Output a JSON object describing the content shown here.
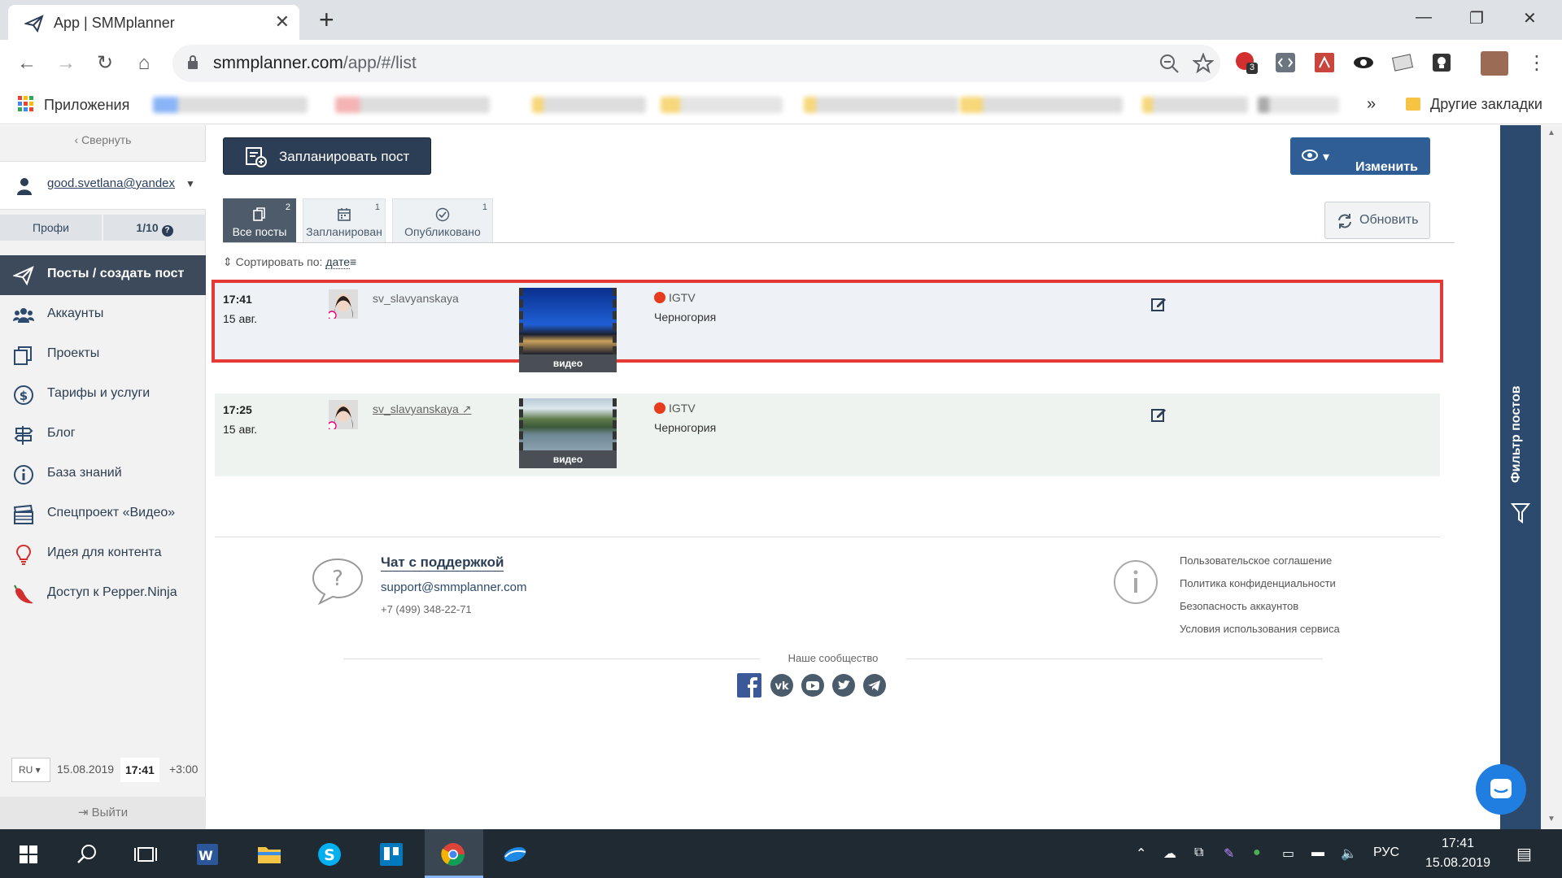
{
  "browser": {
    "tab_title": "App | SMMplanner",
    "url_host": "smmplanner.com",
    "url_path": "/app/#/list",
    "ext_badge": "3",
    "bookmarks_apps": "Приложения",
    "bookmarks_more": "»",
    "bookmarks_other": "Другие закладки"
  },
  "sidebar": {
    "collapse": "‹ Свернуть",
    "account": "good.svetlana@yandex",
    "plan_name": "Профи",
    "plan_usage": "1/10",
    "menu": [
      {
        "label": "Посты / создать пост",
        "icon": "paper-plane-icon"
      },
      {
        "label": "Аккаунты",
        "icon": "users-icon"
      },
      {
        "label": "Проекты",
        "icon": "projects-icon"
      },
      {
        "label": "Тарифы и услуги",
        "icon": "dollar-icon"
      },
      {
        "label": "Блог",
        "icon": "signpost-icon"
      },
      {
        "label": "База знаний",
        "icon": "info-icon"
      },
      {
        "label": "Спецпроект «Видео»",
        "icon": "clapperboard-icon"
      },
      {
        "label": "Идея для контента",
        "icon": "lightbulb-icon"
      },
      {
        "label": "Доступ к Pepper.Ninja",
        "icon": "pepper-icon"
      }
    ],
    "lang": "RU",
    "date": "15.08.2019",
    "time": "17:41",
    "tz": "+3:00",
    "logout": "Выйти"
  },
  "main": {
    "plan_button": "Запланировать пост",
    "view_button": "Изменить вид",
    "refresh_button": "Обновить",
    "tabs": [
      {
        "label": "Все посты",
        "count": "2"
      },
      {
        "label": "Запланирован",
        "count": "1"
      },
      {
        "label": "Опубликовано",
        "count": "1"
      }
    ],
    "sort_label": "Сортировать по:",
    "sort_value": "дате",
    "posts": [
      {
        "time": "17:41",
        "date": "15 авг.",
        "user": "sv_slavyanskaya",
        "network": "IGTV",
        "text": "Черногория",
        "media": "видео"
      },
      {
        "time": "17:25",
        "date": "15 авг.",
        "user": "sv_slavyanskaya",
        "network": "IGTV",
        "text": "Черногория",
        "media": "видео"
      }
    ],
    "footer": {
      "chat": "Чат с поддержкой",
      "email": "support@smmplanner.com",
      "phone": "+7 (499) 348-22-71",
      "links": [
        "Пользовательское соглашение",
        "Политика конфиденциальности",
        "Безопасность аккаунтов",
        "Условия использования сервиса"
      ],
      "community": "Наше сообщество"
    },
    "filter": "Фильтр постов"
  },
  "taskbar": {
    "lang": "РУС",
    "time": "17:41",
    "date": "15.08.2019"
  },
  "colors": {
    "accent_dark": "#2c3e56",
    "accent_blue": "#2e5e95",
    "highlight": "#e53935",
    "filter_strip": "#2c4a6e"
  }
}
